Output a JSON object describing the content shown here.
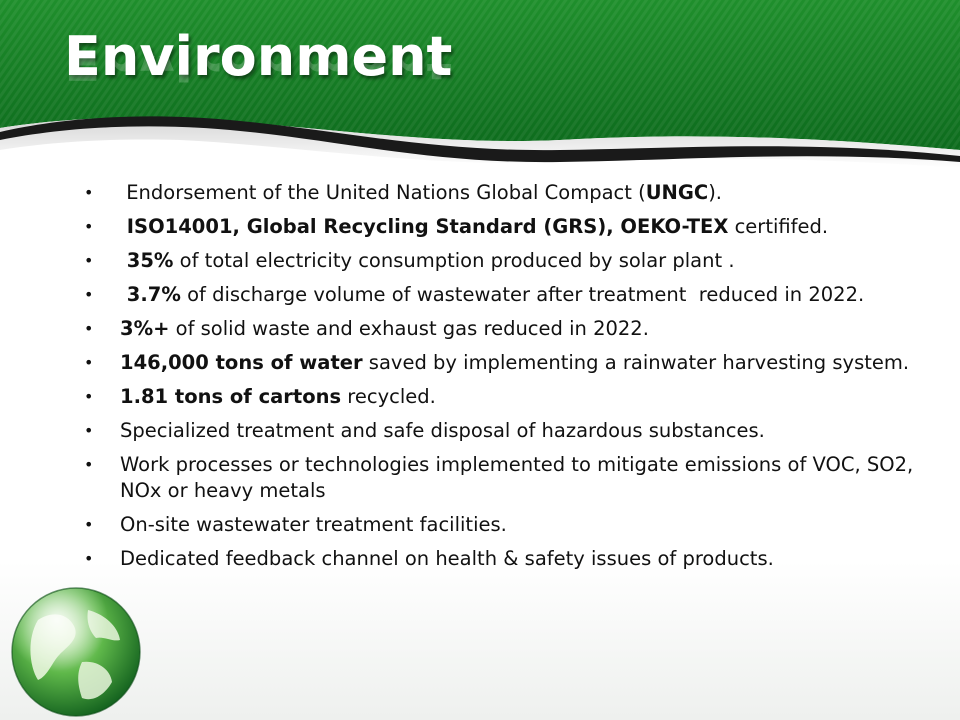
{
  "slide": {
    "title": "Environment",
    "bullet_symbol": "•",
    "bullets": [
      {
        "parts": [
          {
            "t": " Endorsement of the United Nations Global Compact (",
            "b": false
          },
          {
            "t": "UNGC",
            "b": true
          },
          {
            "t": ").",
            "b": false
          }
        ]
      },
      {
        "parts": [
          {
            "t": " ISO14001, Global Recycling Standard (GRS), OEKO-TEX",
            "b": true
          },
          {
            "t": " certififed.",
            "b": false
          }
        ]
      },
      {
        "parts": [
          {
            "t": " 35%",
            "b": true
          },
          {
            "t": " of total electricity consumption produced by solar plant .",
            "b": false
          }
        ]
      },
      {
        "parts": [
          {
            "t": " 3.7%",
            "b": true
          },
          {
            "t": " of discharge volume of wastewater after treatment  reduced in 2022.",
            "b": false
          }
        ]
      },
      {
        "parts": [
          {
            "t": "3%+",
            "b": true
          },
          {
            "t": " of solid waste and exhaust gas reduced in 2022.",
            "b": false
          }
        ]
      },
      {
        "parts": [
          {
            "t": "146,000 tons of water",
            "b": true
          },
          {
            "t": " saved by implementing a rainwater harvesting system.",
            "b": false
          }
        ]
      },
      {
        "parts": [
          {
            "t": "1.81 tons of cartons",
            "b": true
          },
          {
            "t": " recycled.",
            "b": false
          }
        ]
      },
      {
        "parts": [
          {
            "t": "Specialized treatment and safe disposal of hazardous substances.",
            "b": false
          }
        ]
      },
      {
        "parts": [
          {
            "t": "Work processes or technologies implemented to mitigate emissions of VOC, SO2, NOx or heavy metals",
            "b": false
          }
        ]
      },
      {
        "parts": [
          {
            "t": "On-site wastewater treatment facilities.",
            "b": false
          }
        ]
      },
      {
        "parts": [
          {
            "t": "Dedicated feedback channel on health & safety issues of products.",
            "b": false
          }
        ]
      }
    ]
  },
  "colors": {
    "header_green_dark": "#0f7a22",
    "header_green_light": "#3cae3a",
    "swoosh_dark": "#1a1a1a",
    "text": "#111111",
    "title": "#ffffff"
  },
  "icons": {
    "globe": "globe-icon"
  }
}
